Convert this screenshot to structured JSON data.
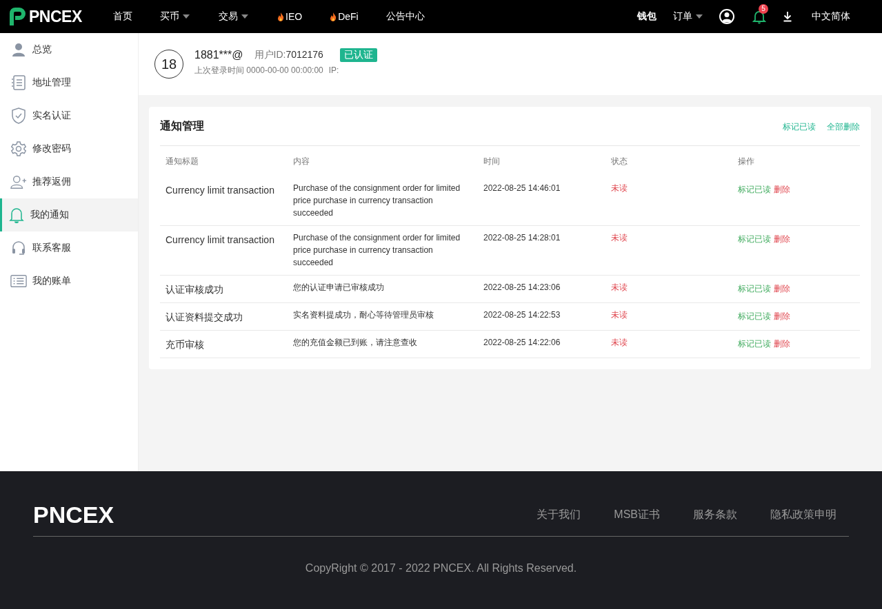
{
  "header": {
    "logo": "PNCEX",
    "nav": [
      {
        "label": "首页",
        "dropdown": false,
        "hot": false
      },
      {
        "label": "买币",
        "dropdown": true,
        "hot": false
      },
      {
        "label": "交易",
        "dropdown": true,
        "hot": false
      },
      {
        "label": "IEO",
        "dropdown": false,
        "hot": true
      },
      {
        "label": "DeFi",
        "dropdown": false,
        "hot": true
      },
      {
        "label": "公告中心",
        "dropdown": false,
        "hot": false
      }
    ],
    "right": [
      {
        "label": "钱包",
        "dropdown": false
      },
      {
        "label": "订单",
        "dropdown": true
      }
    ],
    "notification_count": "5",
    "language": "中文简体"
  },
  "sidebar": {
    "items": [
      {
        "label": "总览",
        "selected": false
      },
      {
        "label": "地址管理",
        "selected": false
      },
      {
        "label": "实名认证",
        "selected": false
      },
      {
        "label": "修改密码",
        "selected": false
      },
      {
        "label": "推荐返佣",
        "selected": false
      },
      {
        "label": "我的通知",
        "selected": true
      },
      {
        "label": "联系客服",
        "selected": false
      },
      {
        "label": "我的账单",
        "selected": false
      }
    ]
  },
  "profile": {
    "avatar": "18",
    "account": "1881***@",
    "user_id_label": "用户ID:",
    "user_id": "7012176",
    "badge": "已认证",
    "last_login": "上次登录时间 0000-00-00 00:00:00",
    "ip": "IP:"
  },
  "notices": {
    "title": "通知管理",
    "actions": [
      "标记已读",
      "全部删除"
    ],
    "columns": [
      "通知标题",
      "内容",
      "时间",
      "状态",
      "操作"
    ],
    "rows": [
      {
        "title": "Currency limit transaction",
        "content": "Purchase of the consignment order for limited price purchase in currency transaction succeeded",
        "time": "2022-08-25 14:46:01",
        "status": "未读",
        "mark": "标记已读",
        "delete": "删除"
      },
      {
        "title": "Currency limit transaction",
        "content": "Purchase of the consignment order for limited price purchase in currency transaction succeeded",
        "time": "2022-08-25 14:28:01",
        "status": "未读",
        "mark": "标记已读",
        "delete": "删除"
      },
      {
        "title": "认证审核成功",
        "content": "您的认证申请已审核成功",
        "time": "2022-08-25 14:23:06",
        "status": "未读",
        "mark": "标记已读",
        "delete": "删除"
      },
      {
        "title": "认证资料提交成功",
        "content": "实名资料提成功，耐心等待管理员审核",
        "time": "2022-08-25 14:22:53",
        "status": "未读",
        "mark": "标记已读",
        "delete": "删除"
      },
      {
        "title": "充币审核",
        "content": "您的充值金额已到账，请注意查收",
        "time": "2022-08-25 14:22:06",
        "status": "未读",
        "mark": "标记已读",
        "delete": "删除"
      }
    ]
  },
  "footer": {
    "logo": "PNCEX",
    "links": [
      "关于我们",
      "MSB证书",
      "服务条款",
      "隐私政策申明"
    ],
    "copyright": "CopyRight © 2017 - 2022 PNCEX. All Rights Reserved."
  }
}
